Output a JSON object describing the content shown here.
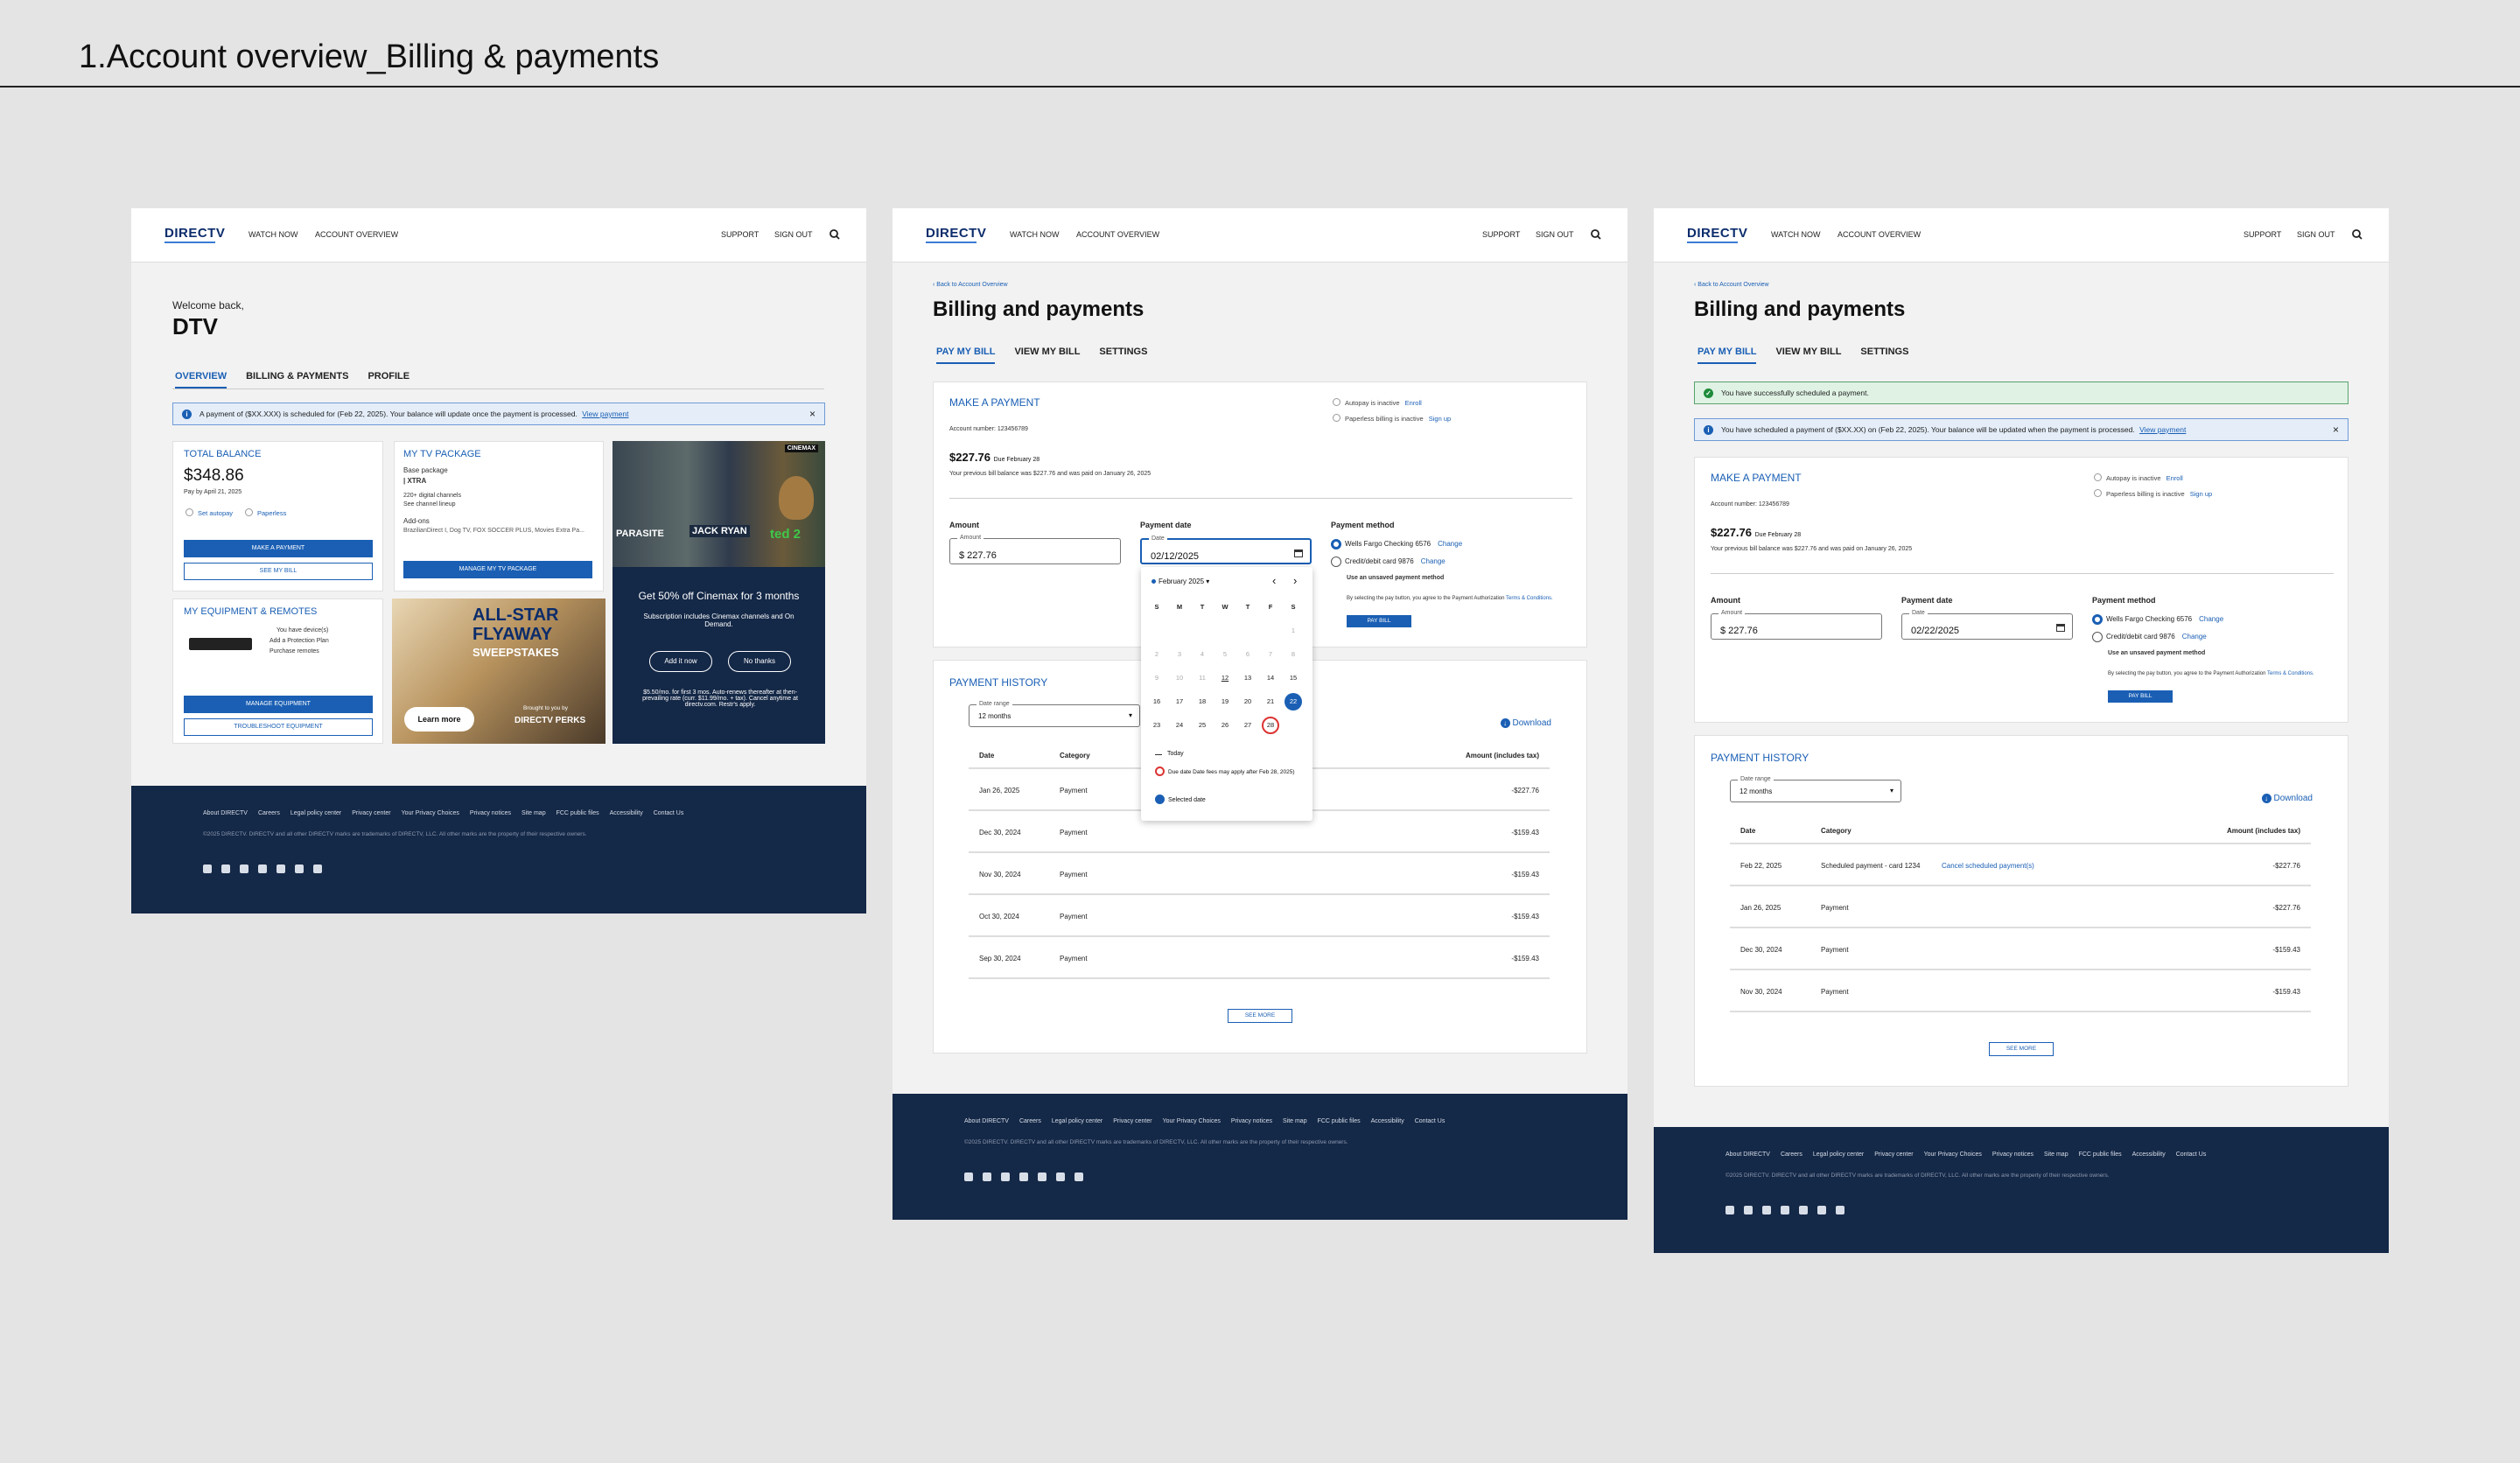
{
  "page": {
    "title": "1.Account overview_Billing & payments"
  },
  "common": {
    "logo": "DIRECTV",
    "nav_left": [
      "WATCH NOW",
      "ACCOUNT OVERVIEW"
    ],
    "nav_right": [
      "SUPPORT",
      "SIGN OUT"
    ],
    "footer_links": [
      "About DIRECTV",
      "Careers",
      "Legal policy center",
      "Privacy center",
      "Your Privacy Choices",
      "Privacy notices",
      "Site map",
      "FCC public files",
      "Accessibility",
      "Contact Us"
    ],
    "footer_copy": "©2025 DIRECTV. DIRECTV and all other DIRECTV marks are trademarks of DIRECTV, LLC. All other marks are the property of their respective owners.",
    "social_icons": [
      "linkedin-icon",
      "facebook-icon",
      "x-icon",
      "instagram-icon",
      "youtube-icon",
      "tiktok-icon",
      "threads-icon"
    ],
    "accent": "#1a5fb4",
    "footer_bg": "#142847"
  },
  "overview": {
    "welcome": "Welcome back,",
    "name": "DTV",
    "tabs": [
      "OVERVIEW",
      "BILLING & PAYMENTS",
      "PROFILE"
    ],
    "alert": "A payment of ($XX.XXX) is scheduled for (Feb 22, 2025). Your balance will update once the payment is processed.",
    "alert_link": "View payment",
    "balance": {
      "title": "TOTAL BALANCE",
      "amount": "$348.86",
      "due": "Pay by April 21, 2025",
      "autopay": "Set autopay",
      "paperless": "Paperless",
      "btn_pay": "MAKE A PAYMENT",
      "btn_bill": "SEE MY BILL"
    },
    "tv": {
      "title": "MY TV PACKAGE",
      "base_label": "Base package",
      "base_name": "| XTRA",
      "channels": "220+ digital channels",
      "lineup": "See channel lineup",
      "addons_label": "Add-ons",
      "addons": "BrazilianDirect I, Dog TV, FOX SOCCER PLUS, Movies Extra Pa...",
      "btn": "MANAGE MY TV PACKAGE"
    },
    "equip": {
      "title": "MY EQUIPMENT & REMOTES",
      "devices": "You have device(s)",
      "protection": "Add a Protection Plan",
      "remotes": "Purchase remotes",
      "btn_manage": "MANAGE EQUIPMENT",
      "btn_trouble": "TROUBLESHOOT EQUIPMENT"
    },
    "cinemax": {
      "brand": "CINEMAX",
      "posters": [
        "PARASITE",
        "JACK RYAN",
        "ted 2"
      ],
      "headline": "Get 50% off Cinemax for 3 months",
      "sub": "Subscription includes Cinemax channels and On Demand.",
      "btn_add": "Add it now",
      "btn_no": "No thanks",
      "fine": "$5.50/mo. for first 3 mos. Auto-renews thereafter at then-prevailing rate (curr. $11.99/mo. + tax). Cancel anytime at directv.com. Restr's apply."
    },
    "promo": {
      "line1": "ALL-STAR",
      "line2": "FLYAWAY",
      "line3": "SWEEPSTAKES",
      "brought": "Brought to you by",
      "perks": "DIRECTV PERKS",
      "btn": "Learn more"
    }
  },
  "billing": {
    "back": "Back to Account Overview",
    "title": "Billing and payments",
    "tabs": [
      "PAY MY BILL",
      "VIEW MY BILL",
      "SETTINGS"
    ],
    "make_payment": "MAKE A PAYMENT",
    "autopay": "Autopay is inactive",
    "enroll": "Enroll",
    "paperless": "Paperless billing is inactive",
    "signup": "Sign up",
    "account": "Account number: 123456789",
    "amount": "$227.76",
    "due": "Due February 28",
    "previous": "Your previous bill balance was $227.76 and was paid on January 26, 2025",
    "amount_label": "Amount",
    "amount_field_label": "Amount",
    "amount_value": "$ 227.76",
    "date_label": "Payment date",
    "date_field_label": "Date",
    "method_label": "Payment method",
    "method1": "Wells Fargo Checking 6576",
    "method2": "Credit/debit card 9876",
    "change": "Change",
    "unsaved": "Use an unsaved payment method",
    "terms_pre": "By selecting the pay button, you agree to the Payment Authorization",
    "terms_link": "Terms & Conditions.",
    "pay_btn": "PAY BILL",
    "history_title": "PAYMENT HISTORY",
    "range_label": "Date range",
    "range_value": "12 months",
    "download": "Download",
    "cols": [
      "Date",
      "Category",
      "Amount (includes tax)"
    ],
    "see_more": "SEE MORE"
  },
  "frame2": {
    "date_value": "02/12/2025",
    "rows": [
      [
        "Jan 26, 2025",
        "Payment",
        "-$227.76"
      ],
      [
        "Dec 30, 2024",
        "Payment",
        "-$159.43"
      ],
      [
        "Nov 30, 2024",
        "Payment",
        "-$159.43"
      ],
      [
        "Oct 30, 2024",
        "Payment",
        "-$159.43"
      ],
      [
        "Sep 30, 2024",
        "Payment",
        "-$159.43"
      ]
    ],
    "calendar": {
      "month": "February 2025",
      "days": [
        "S",
        "M",
        "T",
        "W",
        "T",
        "F",
        "S"
      ],
      "today": "Today",
      "due_note": "Due date Date fees may apply after Feb 28, 2025)",
      "selected": "Selected date"
    }
  },
  "frame3": {
    "success": "You have successfully scheduled a payment.",
    "info": "You have scheduled a payment of ($XX.XX) on (Feb 22, 2025). Your balance will be updated when the payment is processed.",
    "info_link": "View payment",
    "date_value": "02/22/2025",
    "cancel_link": "Cancel scheduled payment(s)",
    "rows": [
      [
        "Feb 22, 2025",
        "Scheduled payment - card 1234",
        "-$227.76"
      ],
      [
        "Jan 26, 2025",
        "Payment",
        "-$227.76"
      ],
      [
        "Dec 30, 2024",
        "Payment",
        "-$159.43"
      ],
      [
        "Nov 30, 2024",
        "Payment",
        "-$159.43"
      ]
    ]
  }
}
